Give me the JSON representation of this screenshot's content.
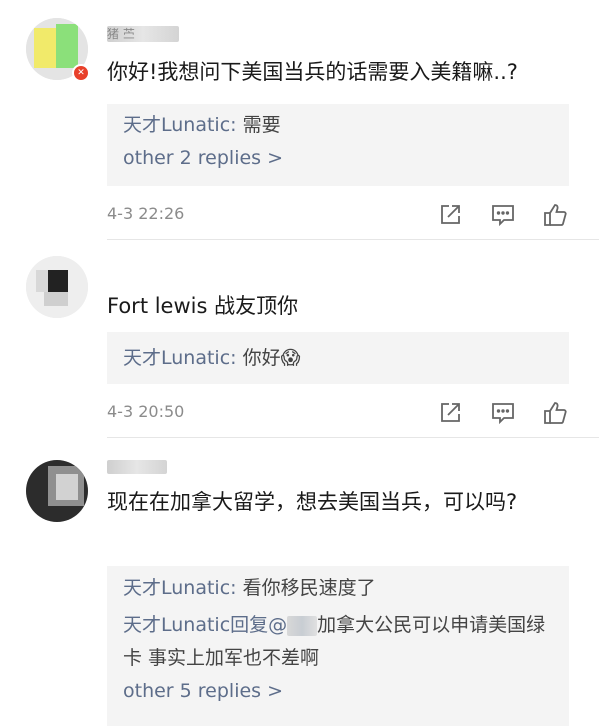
{
  "comments": [
    {
      "username": "猪 苎",
      "text": "你好!我想问下美国当兵的话需要入美籍嘛..?",
      "replies": [
        {
          "author": "天才Lunatic:",
          "content": " 需要"
        }
      ],
      "more_replies": "other 2 replies >",
      "time": "4-3 22:26"
    },
    {
      "username": "",
      "text": "Fort lewis 战友顶你",
      "replies": [
        {
          "author": "天才Lunatic:",
          "content": " 你好😱"
        }
      ],
      "time": "4-3 20:50"
    },
    {
      "username": "",
      "text": "现在在加拿大留学，想去美国当兵，可以吗?",
      "replies": [
        {
          "author": "天才Lunatic:",
          "content": " 看你移民速度了"
        },
        {
          "author": "天才Lunatic回复@",
          "content": "加拿大公民可以申请美国绿卡 事实上加军也不差啊"
        }
      ],
      "more_replies": "other 5 replies >"
    }
  ],
  "icons": {
    "share": "share-icon",
    "comment": "comment-icon",
    "like": "thumbs-up-icon"
  },
  "colors": {
    "link": "#5d6d8a",
    "meta": "#8b8b8b",
    "reply_bg": "#f4f4f4"
  }
}
